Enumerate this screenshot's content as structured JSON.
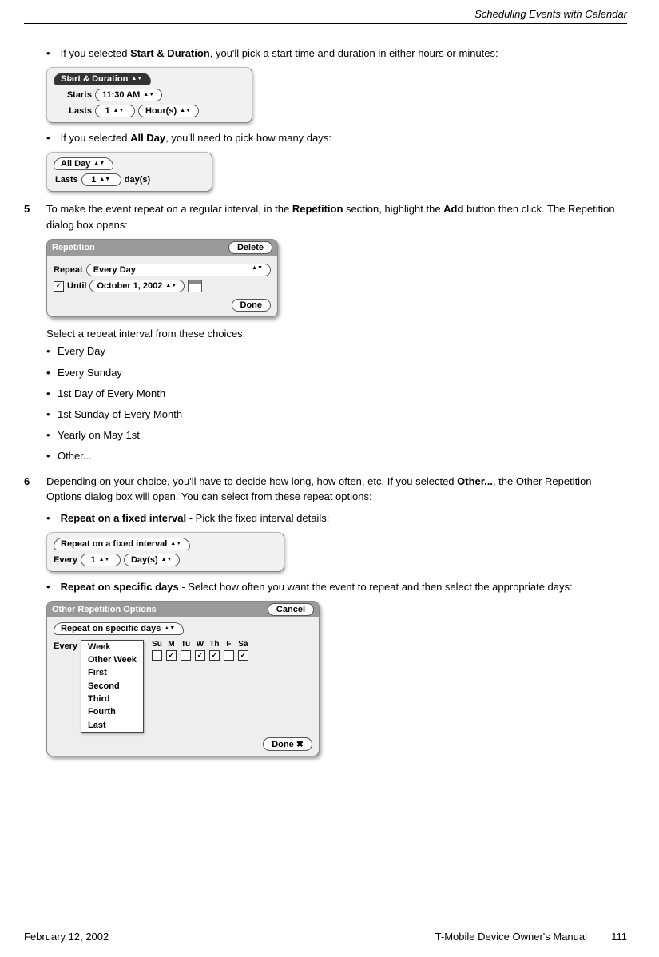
{
  "header": {
    "chapter": "Scheduling Events with Calendar"
  },
  "b1": {
    "pre": "If you selected ",
    "bold": "Start & Duration",
    "post": ", you'll pick a start time and duration in either hours or minutes:"
  },
  "w1": {
    "tab": "Start & Duration",
    "starts_lbl": "Starts",
    "starts_val": "11:30 AM",
    "lasts_lbl": "Lasts",
    "lasts_val": "1",
    "unit": "Hour(s)"
  },
  "b2": {
    "pre": "If you selected ",
    "bold": "All Day",
    "post": ", you'll need to pick how many days:"
  },
  "w2": {
    "tab": "All Day",
    "lasts_lbl": "Lasts",
    "lasts_val": "1",
    "unit": "day(s)"
  },
  "s5": {
    "num": "5",
    "p1a": "To make the event repeat on a regular interval, in the ",
    "p1b": "Repetition",
    "p1c": " section, highlight the ",
    "p1d": "Add",
    "p1e": " button then click. The Repetition dialog box opens:"
  },
  "w3": {
    "title": "Repetition",
    "delete": "Delete",
    "repeat_lbl": "Repeat",
    "repeat_val": "Every Day",
    "until_lbl": "Until",
    "until_val": "October 1, 2002",
    "done": "Done"
  },
  "s5b": {
    "intro": "Select a repeat interval from these choices:",
    "i1": "Every Day",
    "i2": "Every Sunday",
    "i3": "1st Day of Every Month",
    "i4": "1st Sunday of Every Month",
    "i5": "Yearly on May 1st",
    "i6": "Other..."
  },
  "s6": {
    "num": "6",
    "p1a": "Depending on your choice, you'll have to decide how long, how often, etc. If you selected ",
    "p1b": "Other...",
    "p1c": ", the Other Repetition Options dialog box will open. You can select from these repeat options:"
  },
  "b3": {
    "bold": "Repeat on a fixed interval",
    "post": " - Pick the fixed interval details:"
  },
  "w4": {
    "tab": "Repeat on a fixed interval",
    "every_lbl": "Every",
    "val": "1",
    "unit": "Day(s)"
  },
  "b4": {
    "bold": "Repeat on specific days",
    "post": " - Select how often you want the event to repeat and then select the appropriate days:"
  },
  "w5": {
    "title": "Other Repetition Options",
    "cancel": "Cancel",
    "tab": "Repeat on specific days",
    "every_lbl": "Every",
    "opt1": "Week",
    "opt2": "Other Week",
    "opt3": "First",
    "opt4": "Second",
    "opt5": "Third",
    "opt6": "Fourth",
    "opt7": "Last",
    "d0": "Su",
    "d1": "M",
    "d2": "Tu",
    "d3": "W",
    "d4": "Th",
    "d5": "F",
    "d6": "Sa",
    "c0": "",
    "c1": "✓",
    "c2": "",
    "c3": "✓",
    "c4": "✓",
    "c5": "",
    "c6": "✓",
    "done": "Done"
  },
  "footer": {
    "date": "February 12, 2002",
    "title": "T-Mobile Device Owner's Manual",
    "page": "111"
  }
}
